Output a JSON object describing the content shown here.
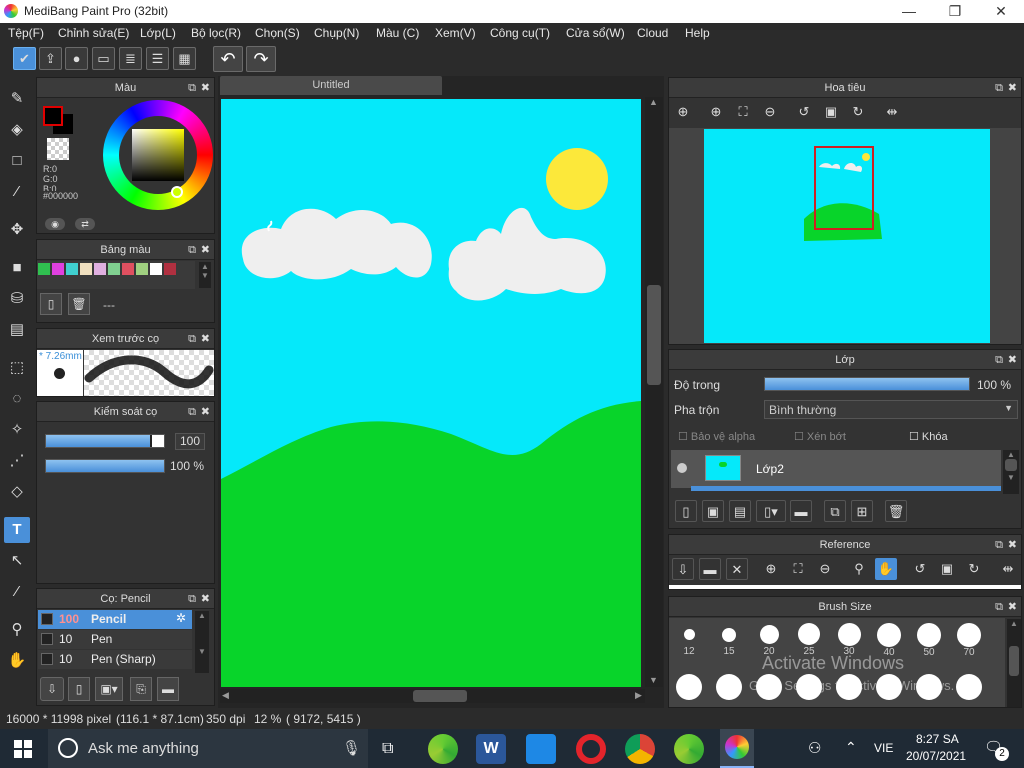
{
  "window": {
    "title": "MediBang Paint Pro (32bit)",
    "minimize": "—",
    "maximize": "❐",
    "close": "✕"
  },
  "menu": [
    "Tệp(F)",
    "Chỉnh sửa(E)",
    "Lớp(L)",
    "Bộ lọc(R)",
    "Chọn(S)",
    "Chụp(N)",
    "Màu (C)",
    "Xem(V)",
    "Công cụ(T)",
    "Cửa sổ(W)",
    "Cloud",
    "Help"
  ],
  "toolbar": {
    "undo": "↶",
    "redo": "↷"
  },
  "color_panel": {
    "title": "Màu",
    "r": "R:0",
    "g": "G:0",
    "b": "B:0",
    "hex": "#000000",
    "primary": "#e00000",
    "secondary": "#000000"
  },
  "palette_panel": {
    "title": "Bảng màu",
    "name": "---",
    "swatches": [
      "#30c050",
      "#e040e0",
      "#40d0d0",
      "#f0e0c0",
      "#e0b0e0",
      "#80d090",
      "#e05060",
      "#a0d080",
      "#e8e8e8",
      "#ffffff",
      "#b03040"
    ]
  },
  "brush_preview": {
    "title": "Xem trước cọ",
    "size": "7.26mm"
  },
  "brush_control": {
    "title": "Kiểm soát cọ",
    "size_value": "100",
    "opacity_value": "100 %",
    "size_level": 0.88,
    "opacity_level": 1.0
  },
  "brush_list": {
    "title": "Cọ: Pencil",
    "items": [
      {
        "size": "100",
        "name": "Pencil"
      },
      {
        "size": "10",
        "name": "Pen"
      },
      {
        "size": "10",
        "name": "Pen (Sharp)"
      }
    ]
  },
  "canvas": {
    "tab": "Untitled",
    "bg": "#05e9fa",
    "hill": "#08d42a",
    "cloud": "#efefef",
    "sun": "#fce83a"
  },
  "navigator": {
    "title": "Hoa tiêu"
  },
  "layer_panel": {
    "title": "Lớp",
    "opacity_label": "Độ trong",
    "opacity_value": "100 %",
    "opacity_level": 1.0,
    "blend_label": "Pha trộn",
    "blend_value": "Bình thường",
    "protect_alpha": "Bảo vệ alpha",
    "clipping": "Xén bớt",
    "lock": "Khóa",
    "layer_name": "Lớp2"
  },
  "reference_panel": {
    "title": "Reference"
  },
  "brush_size_panel": {
    "title": "Brush Size",
    "sizes": [
      "12",
      "15",
      "20",
      "25",
      "30",
      "40",
      "50",
      "70"
    ],
    "watermark_1": "Activate Windows",
    "watermark_2": "Go to Settings to activate Windows."
  },
  "status": {
    "dims": "16000 * 11998 pixel",
    "size_cm": "(116.1 * 87.1cm)",
    "dpi": "350 dpi",
    "zoom": "12 %",
    "coords": "( 9172, 5415 )"
  },
  "taskbar": {
    "search": "Ask me anything",
    "lang": "VIE",
    "time": "8:27 SA",
    "date": "20/07/2021",
    "notif": "2"
  }
}
